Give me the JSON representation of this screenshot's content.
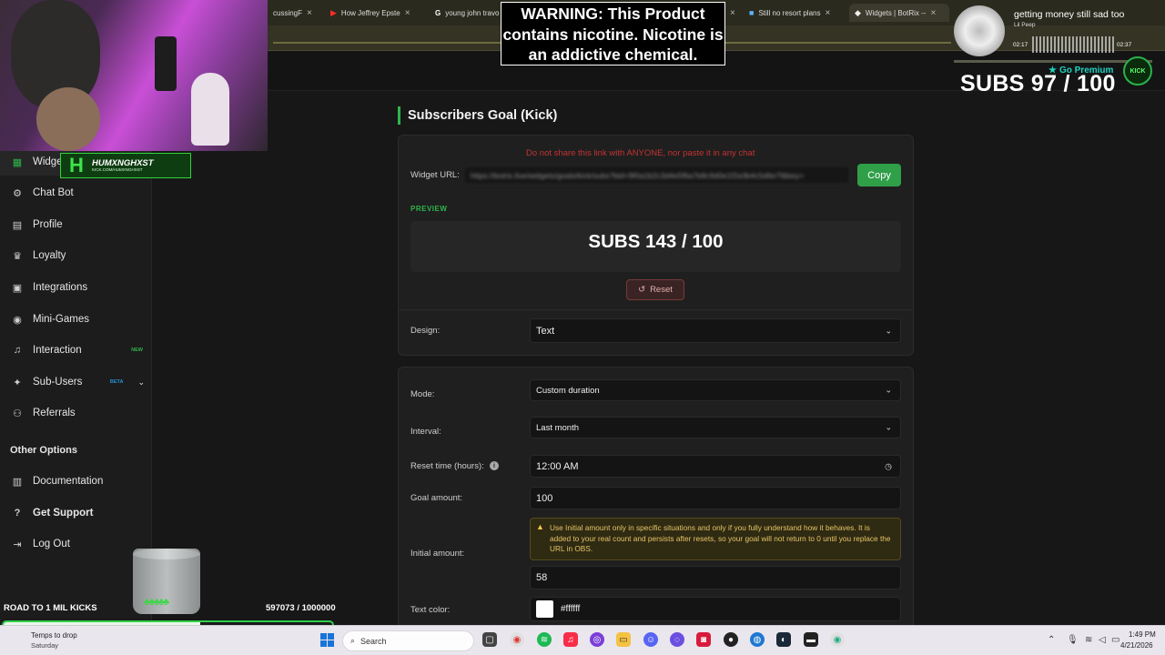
{
  "browser": {
    "tabs": [
      {
        "label": "cussingF",
        "icon": "tab-icon"
      },
      {
        "label": "How Jeffrey Epste",
        "icon": "youtube-icon"
      },
      {
        "label": "young john travo",
        "icon": "google-icon"
      },
      {
        "label": "Still no resort plans",
        "icon": "site-icon"
      },
      {
        "label": "Widgets | BotRix --",
        "icon": "botrix-icon"
      }
    ],
    "close_glyph": "×"
  },
  "overlays": {
    "warning": "WARNING: This Product contains nicotine. Nicotine is an addictive chemical.",
    "music": {
      "song": "getting money still sad too",
      "artist": "Lil Peep",
      "elapsed": "02:17",
      "total": "02:37"
    },
    "premium": "Go Premium",
    "kick_badge": "KICK",
    "subs_overlay": "SUBS 97 / 100",
    "channel_logo": {
      "name": "HUMXNGHXST",
      "url": "KICK.COM/HUMXNGHXST"
    },
    "road": {
      "label": "ROAD TO 1 MIL KICKS",
      "count": "597073 / 1000000",
      "progress": 0.597
    }
  },
  "sidebar": {
    "items": [
      {
        "label": "Widgets",
        "icon": "grid-icon",
        "active": true
      },
      {
        "label": "Chat Bot",
        "icon": "robot-icon"
      },
      {
        "label": "Profile",
        "icon": "id-card-icon"
      },
      {
        "label": "Loyalty",
        "icon": "trophy-icon"
      },
      {
        "label": "Integrations",
        "icon": "plug-icon"
      },
      {
        "label": "Mini-Games",
        "icon": "gamepad-icon"
      },
      {
        "label": "Interaction",
        "icon": "music-icon",
        "badge": "NEW",
        "badge_color": "#2fb54c"
      },
      {
        "label": "Sub-Users",
        "icon": "users-icon",
        "badge": "BETA",
        "badge_color": "#2a8fd6"
      },
      {
        "label": "Referrals",
        "icon": "referral-icon"
      }
    ],
    "other_title": "Other Options",
    "other_items": [
      {
        "label": "Documentation",
        "icon": "book-icon"
      },
      {
        "label": "Get Support",
        "icon": "question-icon"
      },
      {
        "label": "Log Out",
        "icon": "logout-icon"
      }
    ]
  },
  "main": {
    "title": "Subscribers Goal (Kick)",
    "secret_warning": "Do not share this link with ANYONE, nor paste it in any chat",
    "widget_url_label": "Widget URL:",
    "widget_url": "https://botrix.live/widgets/goals/kick/subs?bid=9f0a1b2c3d4e5f6a7b8c9d0e1f2a3b4c5d6e7f&key=",
    "copy_label": "Copy",
    "preview_label": "PREVIEW",
    "preview_text": "SUBS 143 / 100",
    "reset_label": "Reset",
    "design_label": "Design:",
    "design_value": "Text",
    "mode_label": "Mode:",
    "mode_value": "Custom duration",
    "interval_label": "Interval:",
    "interval_value": "Last month",
    "reset_time_label": "Reset time (hours):",
    "reset_time_value": "12:00 AM",
    "goal_label": "Goal amount:",
    "goal_value": "100",
    "initial_label": "Initial amount:",
    "initial_info": "Use Initial amount only in specific situations and only if you fully understand how it behaves. It is added to your real count and persists after resets, so your goal will not return to 0 until you replace the URL in OBS.",
    "initial_value": "58",
    "text_color_label": "Text color:",
    "text_color_value": "#ffffff"
  },
  "taskbar": {
    "weather_title": "Temps to drop",
    "weather_sub": "Saturday",
    "search_placeholder": "Search",
    "time": "1:49 PM",
    "date": "4/21/2026"
  },
  "colors": {
    "accent": "#2fb54c",
    "danger": "#c43333",
    "warning": "#e6c567"
  }
}
